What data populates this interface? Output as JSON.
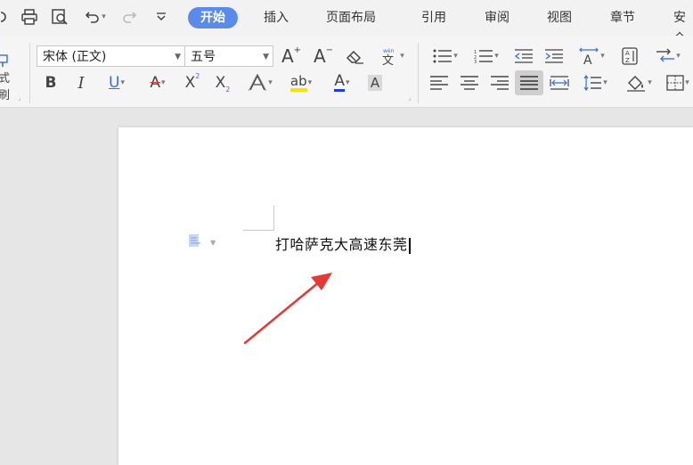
{
  "tabs": {
    "home": "开始",
    "insert": "插入",
    "layout": "页面布局",
    "references": "引用",
    "review": "审阅",
    "view": "视图",
    "chapter": "章节",
    "security": "安全"
  },
  "ribbon": {
    "font_name": "宋体 (正文)",
    "font_size": "五号",
    "format_painter_label": "式刷"
  },
  "document": {
    "text": "打哈萨克大高速东莞"
  },
  "colors": {
    "accent": "#5b8be8",
    "annotation_arrow": "#e53935"
  }
}
